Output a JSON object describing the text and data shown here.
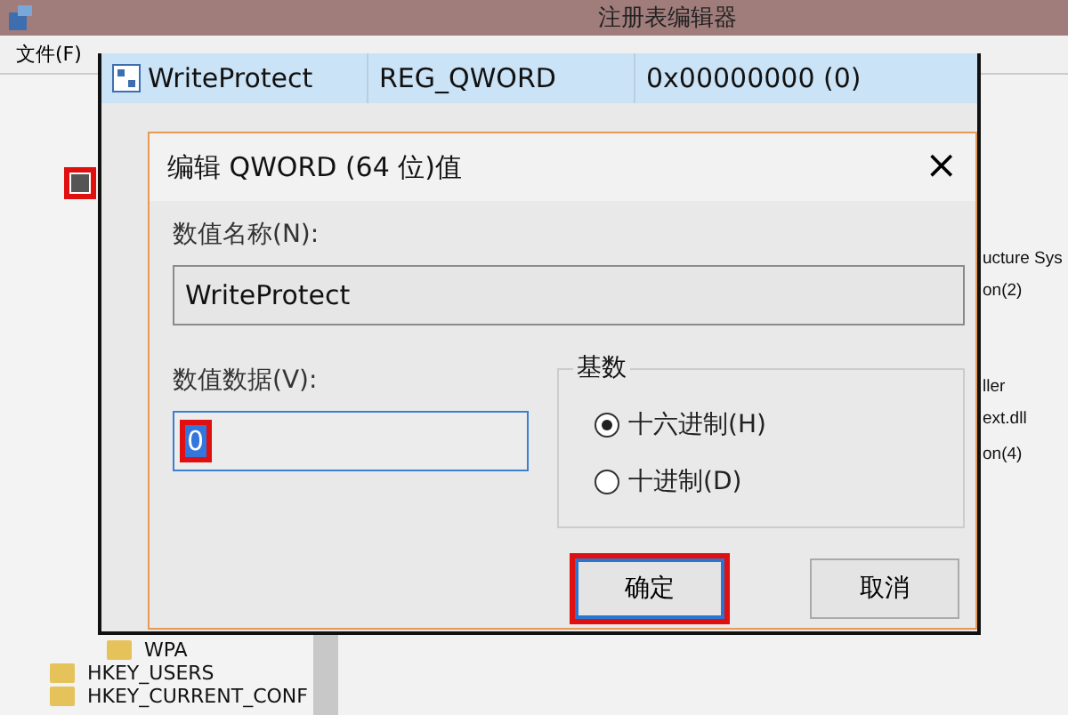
{
  "window": {
    "title": "注册表编辑器"
  },
  "menu": [
    {
      "label": "文件(F)"
    }
  ],
  "tree": [
    {
      "kind": "node",
      "highlighted": true
    },
    {
      "kind": "subkey",
      "label": "WPA",
      "highlighted": false
    },
    {
      "kind": "hive",
      "label": "HKEY_USERS",
      "highlighted": false
    },
    {
      "kind": "hive",
      "label": "HKEY_CURRENT_CONF",
      "highlighted": false
    }
  ],
  "list_fragments": [
    "ucture Sys",
    "on(2)",
    "ller",
    "ext.dll",
    "on(4)"
  ],
  "value_row": {
    "name": "WriteProtect",
    "type": "REG_QWORD",
    "data": "0x00000000 (0)",
    "selected": true
  },
  "dialog": {
    "title": "编辑 QWORD (64 位)值",
    "close": "×",
    "name_label": "数值名称(N):",
    "name_value": "WriteProtect",
    "data_label": "数值数据(V):",
    "data_value": "0",
    "data_highlighted": true,
    "base_label": "基数",
    "radios": [
      {
        "label": "十六进制(H)",
        "selected": true
      },
      {
        "label": "十进制(D)",
        "selected": false
      }
    ],
    "buttons": [
      {
        "label": "确定",
        "default": true,
        "highlighted": true
      },
      {
        "label": "取消",
        "default": false,
        "highlighted": false
      }
    ]
  }
}
